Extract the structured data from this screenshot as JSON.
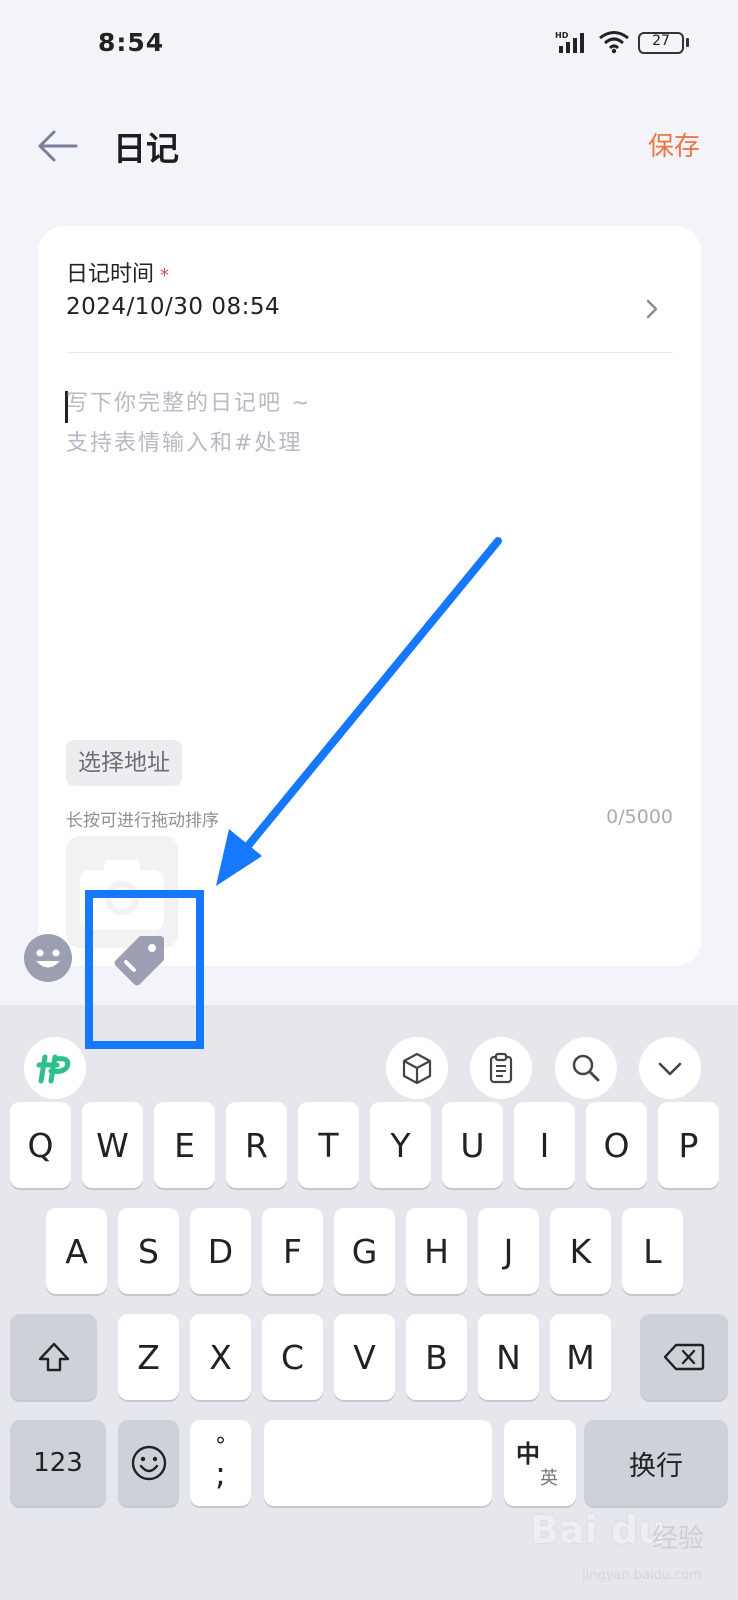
{
  "status": {
    "time": "8:54",
    "network": "HD",
    "battery": "27"
  },
  "header": {
    "title": "日记",
    "save_label": "保存"
  },
  "form": {
    "time_label": "日记时间",
    "required_mark": "*",
    "time_value": "2024/10/30 08:54",
    "editor_placeholder_line1": "写下你完整的日记吧 ~",
    "editor_placeholder_line2": "支持表情输入和#处理",
    "address_button": "选择地址",
    "drag_hint": "长按可进行拖动排序",
    "char_counter": "0/5000"
  },
  "keyboard": {
    "row1": [
      "Q",
      "W",
      "E",
      "R",
      "T",
      "Y",
      "U",
      "I",
      "O",
      "P"
    ],
    "row2": [
      "A",
      "S",
      "D",
      "F",
      "G",
      "H",
      "J",
      "K",
      "L"
    ],
    "row3": [
      "Z",
      "X",
      "C",
      "V",
      "B",
      "N",
      "M"
    ],
    "numbers_key": "123",
    "punct_top": "°",
    "punct_bottom": ";",
    "lang_zh": "中",
    "lang_en": "英",
    "enter_key": "换行"
  },
  "watermark": {
    "logo": "Bai du",
    "text": "经验",
    "sub": "jingyan.baidu.com"
  },
  "colors": {
    "accent": "#ee7645",
    "annotation": "#1677ff",
    "keyboard_bg": "#e6e7ec"
  }
}
